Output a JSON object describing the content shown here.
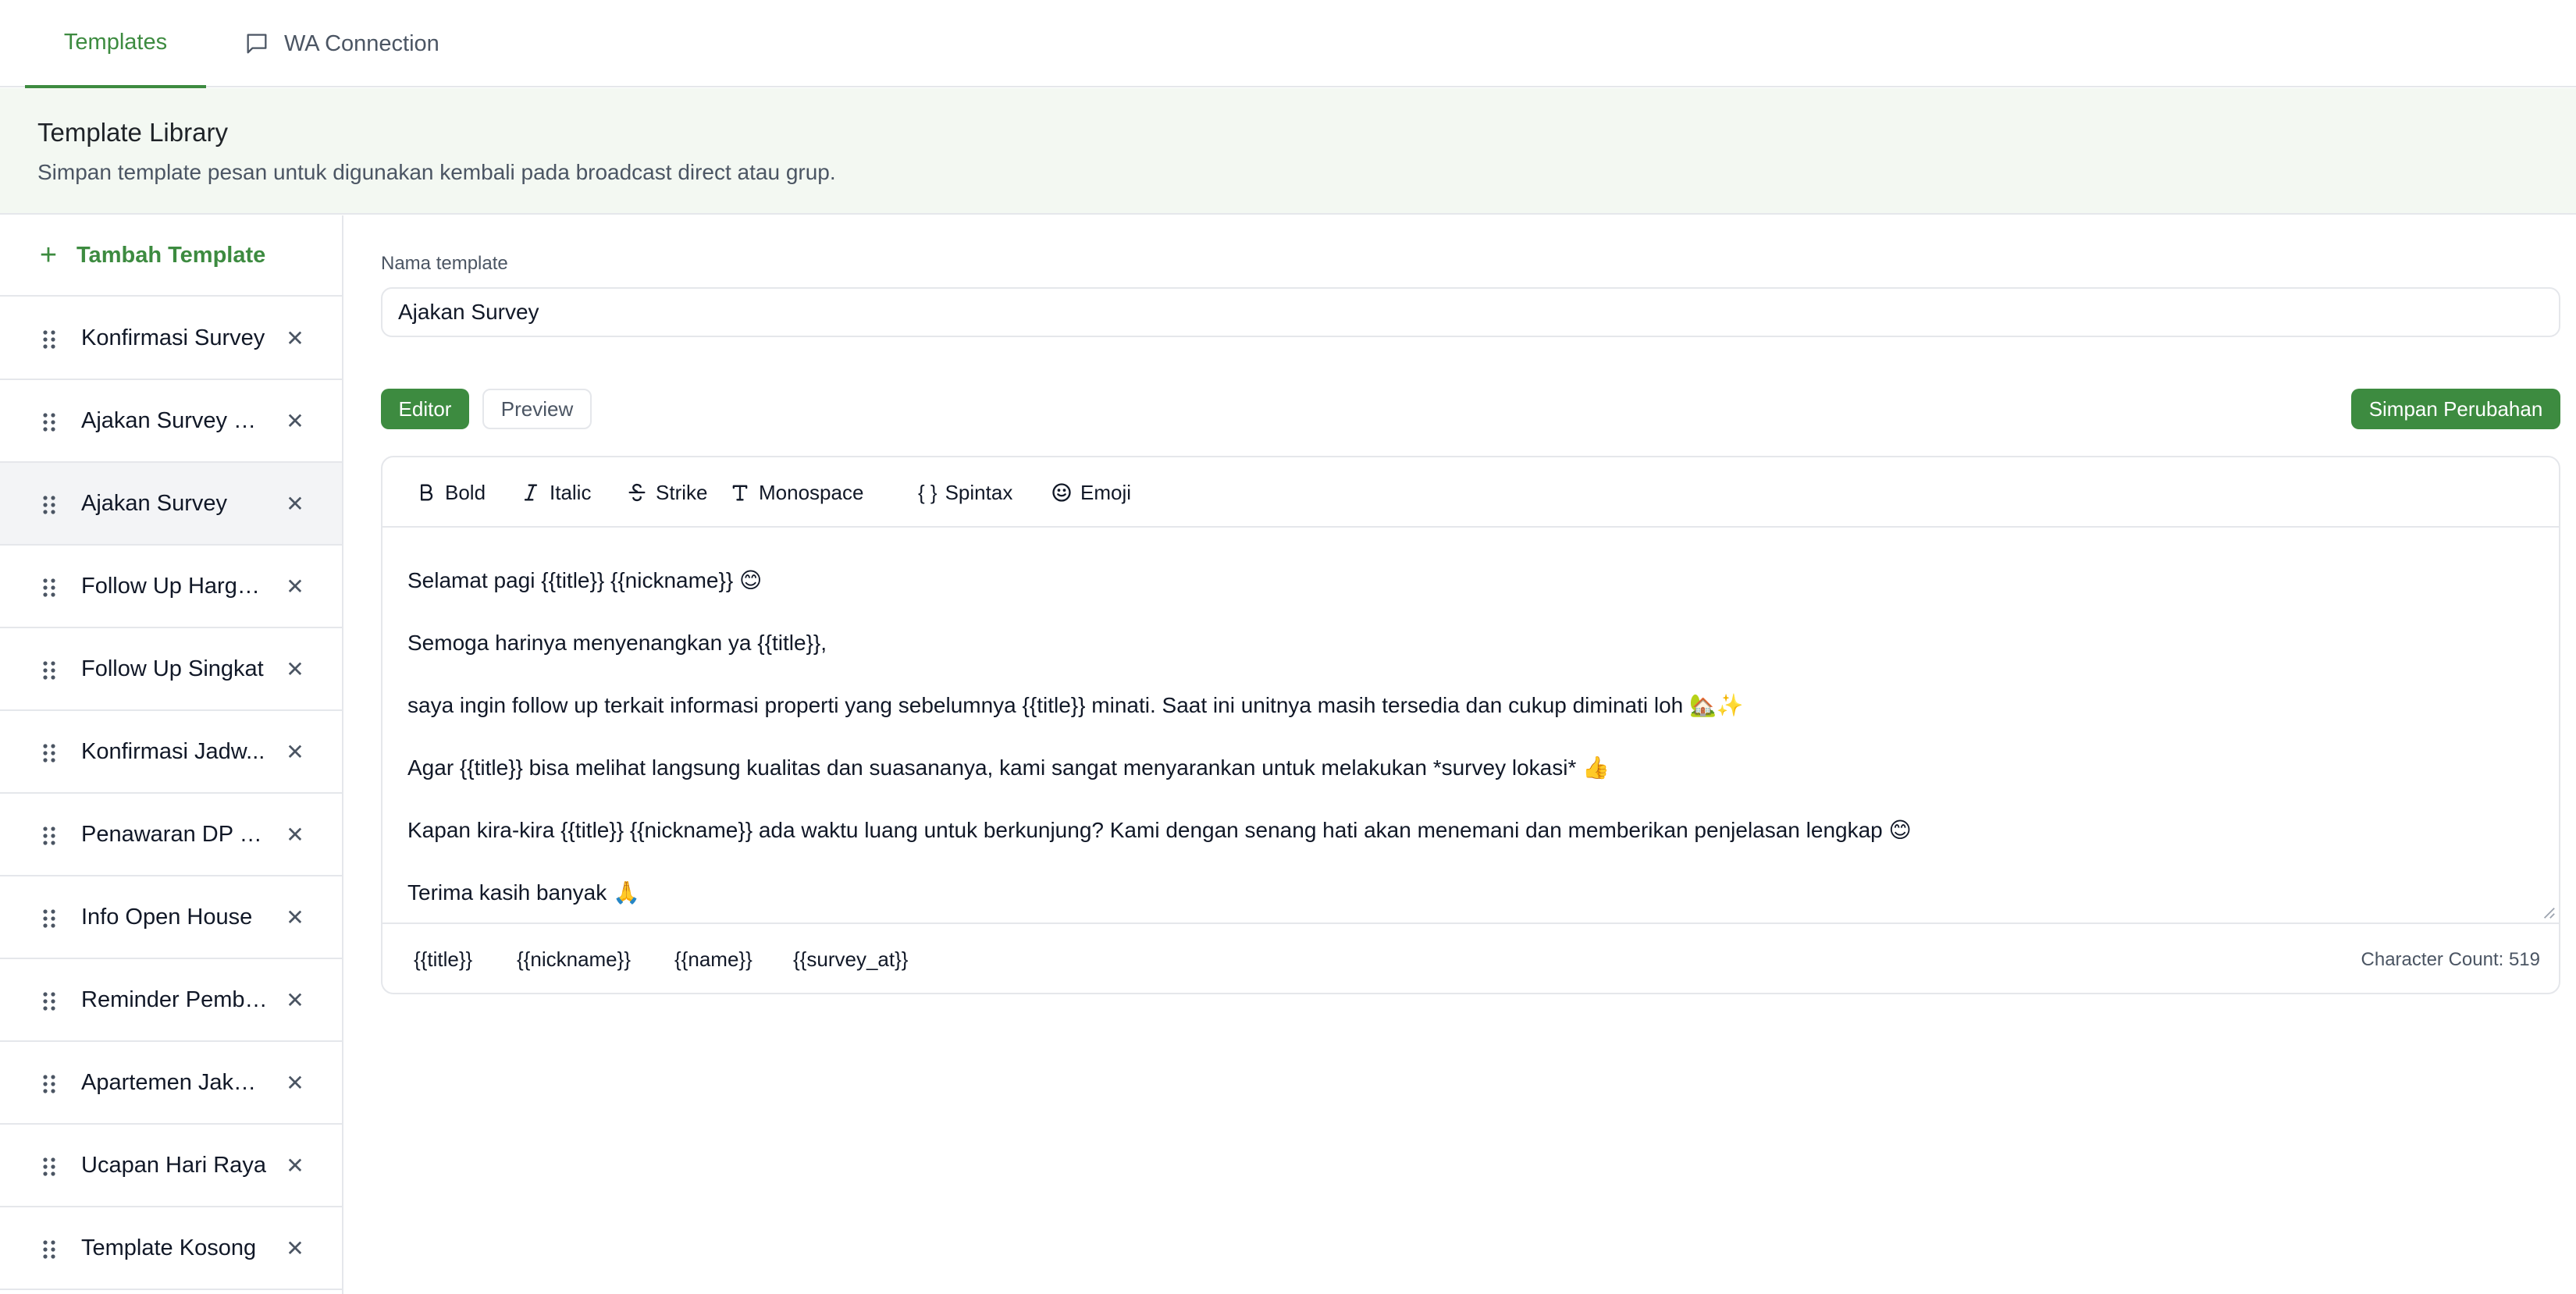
{
  "tabs": {
    "templates": "Templates",
    "wa_connection": "WA Connection"
  },
  "banner": {
    "title": "Template Library",
    "description": "Simpan template pesan untuk digunakan kembali pada broadcast direct atau grup."
  },
  "sidebar": {
    "add_label": "Tambah Template",
    "items": [
      {
        "label": "Konfirmasi Survey"
      },
      {
        "label": "Ajakan Survey Pr..."
      },
      {
        "label": "Ajakan Survey"
      },
      {
        "label": "Follow Up Harga ..."
      },
      {
        "label": "Follow Up Singkat"
      },
      {
        "label": "Konfirmasi Jadw..."
      },
      {
        "label": "Penawaran DP Ri..."
      },
      {
        "label": "Info Open House"
      },
      {
        "label": "Reminder Pemba..."
      },
      {
        "label": "Apartemen Jakar..."
      },
      {
        "label": "Ucapan Hari Raya"
      },
      {
        "label": "Template Kosong"
      }
    ],
    "selected_index": 2
  },
  "form": {
    "name_label": "Nama template",
    "name_value": "Ajakan Survey"
  },
  "modes": {
    "editor": "Editor",
    "preview": "Preview",
    "active": "editor"
  },
  "save_label": "Simpan Perubahan",
  "toolbar": {
    "bold": "Bold",
    "italic": "Italic",
    "strike": "Strike",
    "monospace": "Monospace",
    "spintax": "Spintax",
    "emoji": "Emoji"
  },
  "editor": {
    "lines": [
      "Selamat pagi {{title}} {{nickname}} 😊",
      "Semoga harinya menyenangkan ya {{title}},",
      "saya ingin follow up terkait informasi properti yang sebelumnya {{title}} minati. Saat ini unitnya masih tersedia dan cukup diminati loh 🏡✨",
      "Agar {{title}} bisa melihat langsung kualitas dan suasananya, kami sangat menyarankan untuk melakukan *survey lokasi* 👍",
      "Kapan kira-kira {{title}} {{nickname}} ada waktu luang untuk berkunjung? Kami dengan senang hati akan menemani dan memberikan penjelasan lengkap 😊",
      "Terima kasih banyak 🙏"
    ]
  },
  "variables": [
    "{{title}}",
    "{{nickname}}",
    "{{name}}",
    "{{survey_at}}"
  ],
  "char_count": "Character Count: 519",
  "colors": {
    "accent": "#3d8b40",
    "banner_bg": "#f3f8f2",
    "border": "#e5e7eb",
    "selected_bg": "#f3f4f6"
  }
}
